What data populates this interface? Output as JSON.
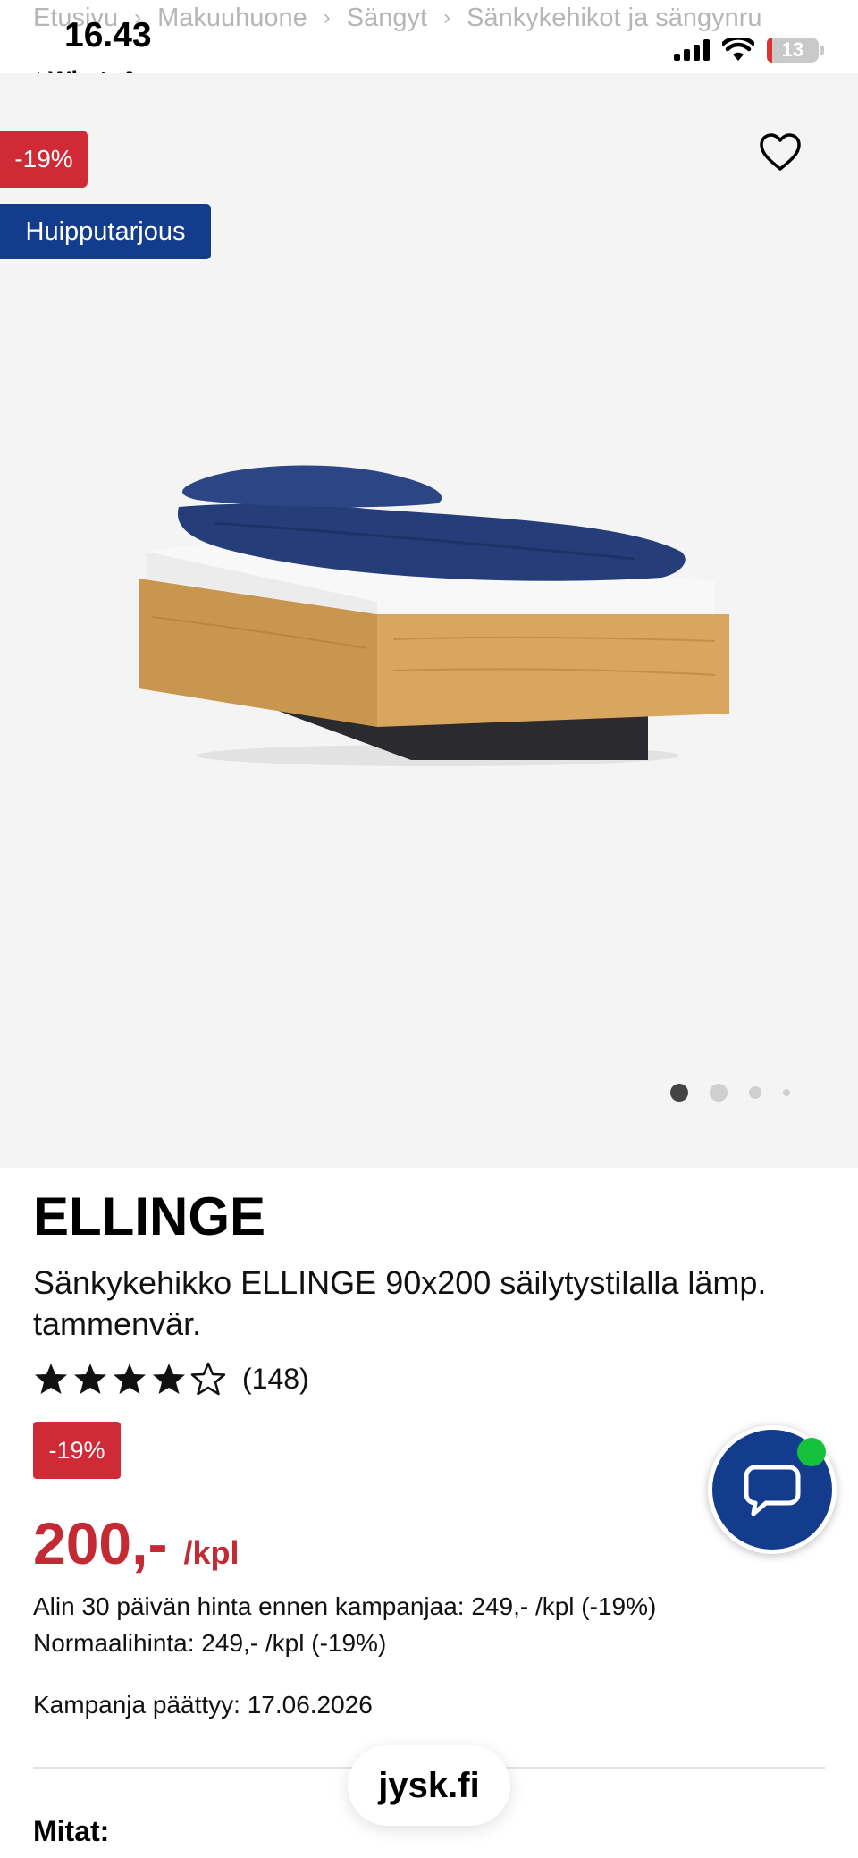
{
  "breadcrumb": [
    "Etusivu",
    "Makuuhuone",
    "Sängyt",
    "Sänkykehikot ja sängynru"
  ],
  "status": {
    "time": "16.43",
    "back_app": "WhatsApp",
    "battery": "13"
  },
  "badges": {
    "discount": "-19%",
    "deal": "Huipputarjous"
  },
  "product": {
    "brand": "ELLINGE",
    "title": "Sänkykehikko ELLINGE 90x200 säilytystilalla lämp. tammenvär.",
    "rating_value": 4,
    "rating_max": 5,
    "review_count": "(148)",
    "discount_badge": "-19%",
    "price": "200,-",
    "price_unit": "/kpl",
    "lowest_price_line": "Alin 30 päivän hinta ennen kampanjaa: 249,- /kpl (-19%)",
    "normal_price_line": "Normaalihinta: 249,- /kpl (-19%)",
    "campaign_end": "Kampanja päättyy: 17.06.2026"
  },
  "sections": {
    "dimensions_title": "Mitat:"
  },
  "carousel": {
    "count": 4,
    "active": 0
  },
  "url": "jysk.fi",
  "colors": {
    "accent_red": "#cf2a36",
    "accent_blue": "#143c8c",
    "price_red": "#c42a33",
    "online_green": "#16c23c"
  },
  "icons": [
    "heart-icon",
    "chat-icon",
    "star-icon",
    "signal-icon",
    "wifi-icon",
    "battery-icon"
  ]
}
